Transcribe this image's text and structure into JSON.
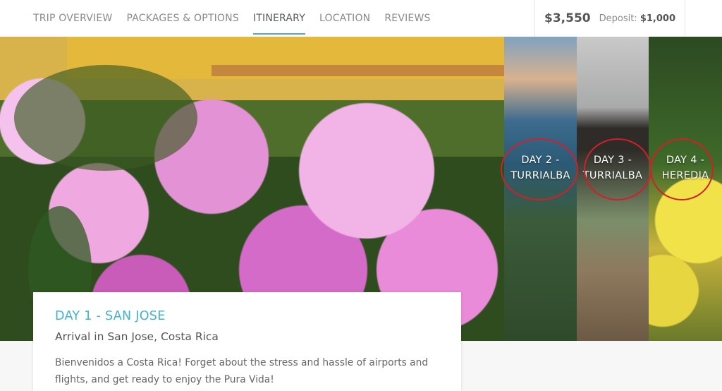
{
  "nav": {
    "tabs": [
      {
        "label": "TRIP OVERVIEW"
      },
      {
        "label": "PACKAGES & OPTIONS"
      },
      {
        "label": "ITINERARY"
      },
      {
        "label": "LOCATION"
      },
      {
        "label": "REVIEWS"
      }
    ],
    "active_tab": "ITINERARY"
  },
  "pricing": {
    "price": "$3,550",
    "deposit_label": "Deposit:",
    "deposit_amount": "$1,000"
  },
  "hero": {
    "days": [
      {
        "line1": "DAY 2 -",
        "line2": "TURRIALBA"
      },
      {
        "line1": "DAY 3 -",
        "line2": "TURRIALBA"
      },
      {
        "line1": "DAY 4 -",
        "line2": "HEREDIA"
      }
    ]
  },
  "card": {
    "day_title": "DAY 1 - SAN JOSE",
    "subtitle": "Arrival in San Jose, Costa Rica",
    "body": "Bienvenidos a Costa Rica!  Forget about the stress and hassle of airports and flights, and get ready to enjoy the Pura Vida!"
  },
  "colors": {
    "accent": "#3fb3cf",
    "annotation_circle": "#d21f2a"
  }
}
